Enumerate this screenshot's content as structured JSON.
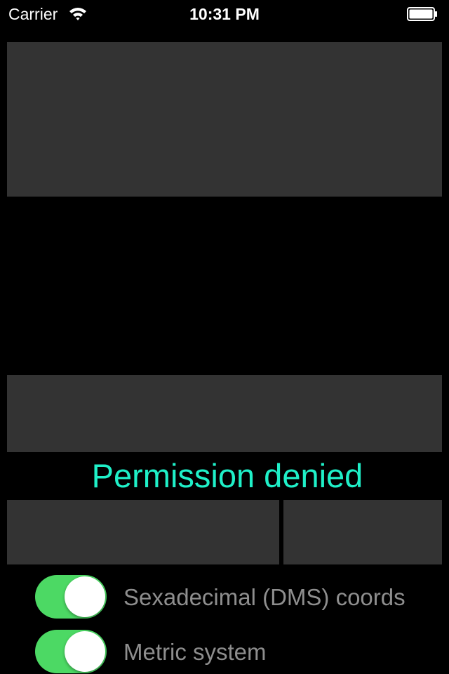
{
  "status_bar": {
    "carrier": "Carrier",
    "time": "10:31 PM",
    "wifi_icon": "wifi-icon",
    "battery_icon": "battery-full-icon"
  },
  "status_message": {
    "text": "Permission denied",
    "color": "#1ff0c8"
  },
  "toggles": [
    {
      "label": "Sexadecimal (DMS) coords",
      "on": true
    },
    {
      "label": "Metric system",
      "on": true
    }
  ],
  "colors": {
    "background": "#000000",
    "panel": "#333333",
    "toggle_on": "#4cd964",
    "toggle_label": "#8e8e8e"
  }
}
